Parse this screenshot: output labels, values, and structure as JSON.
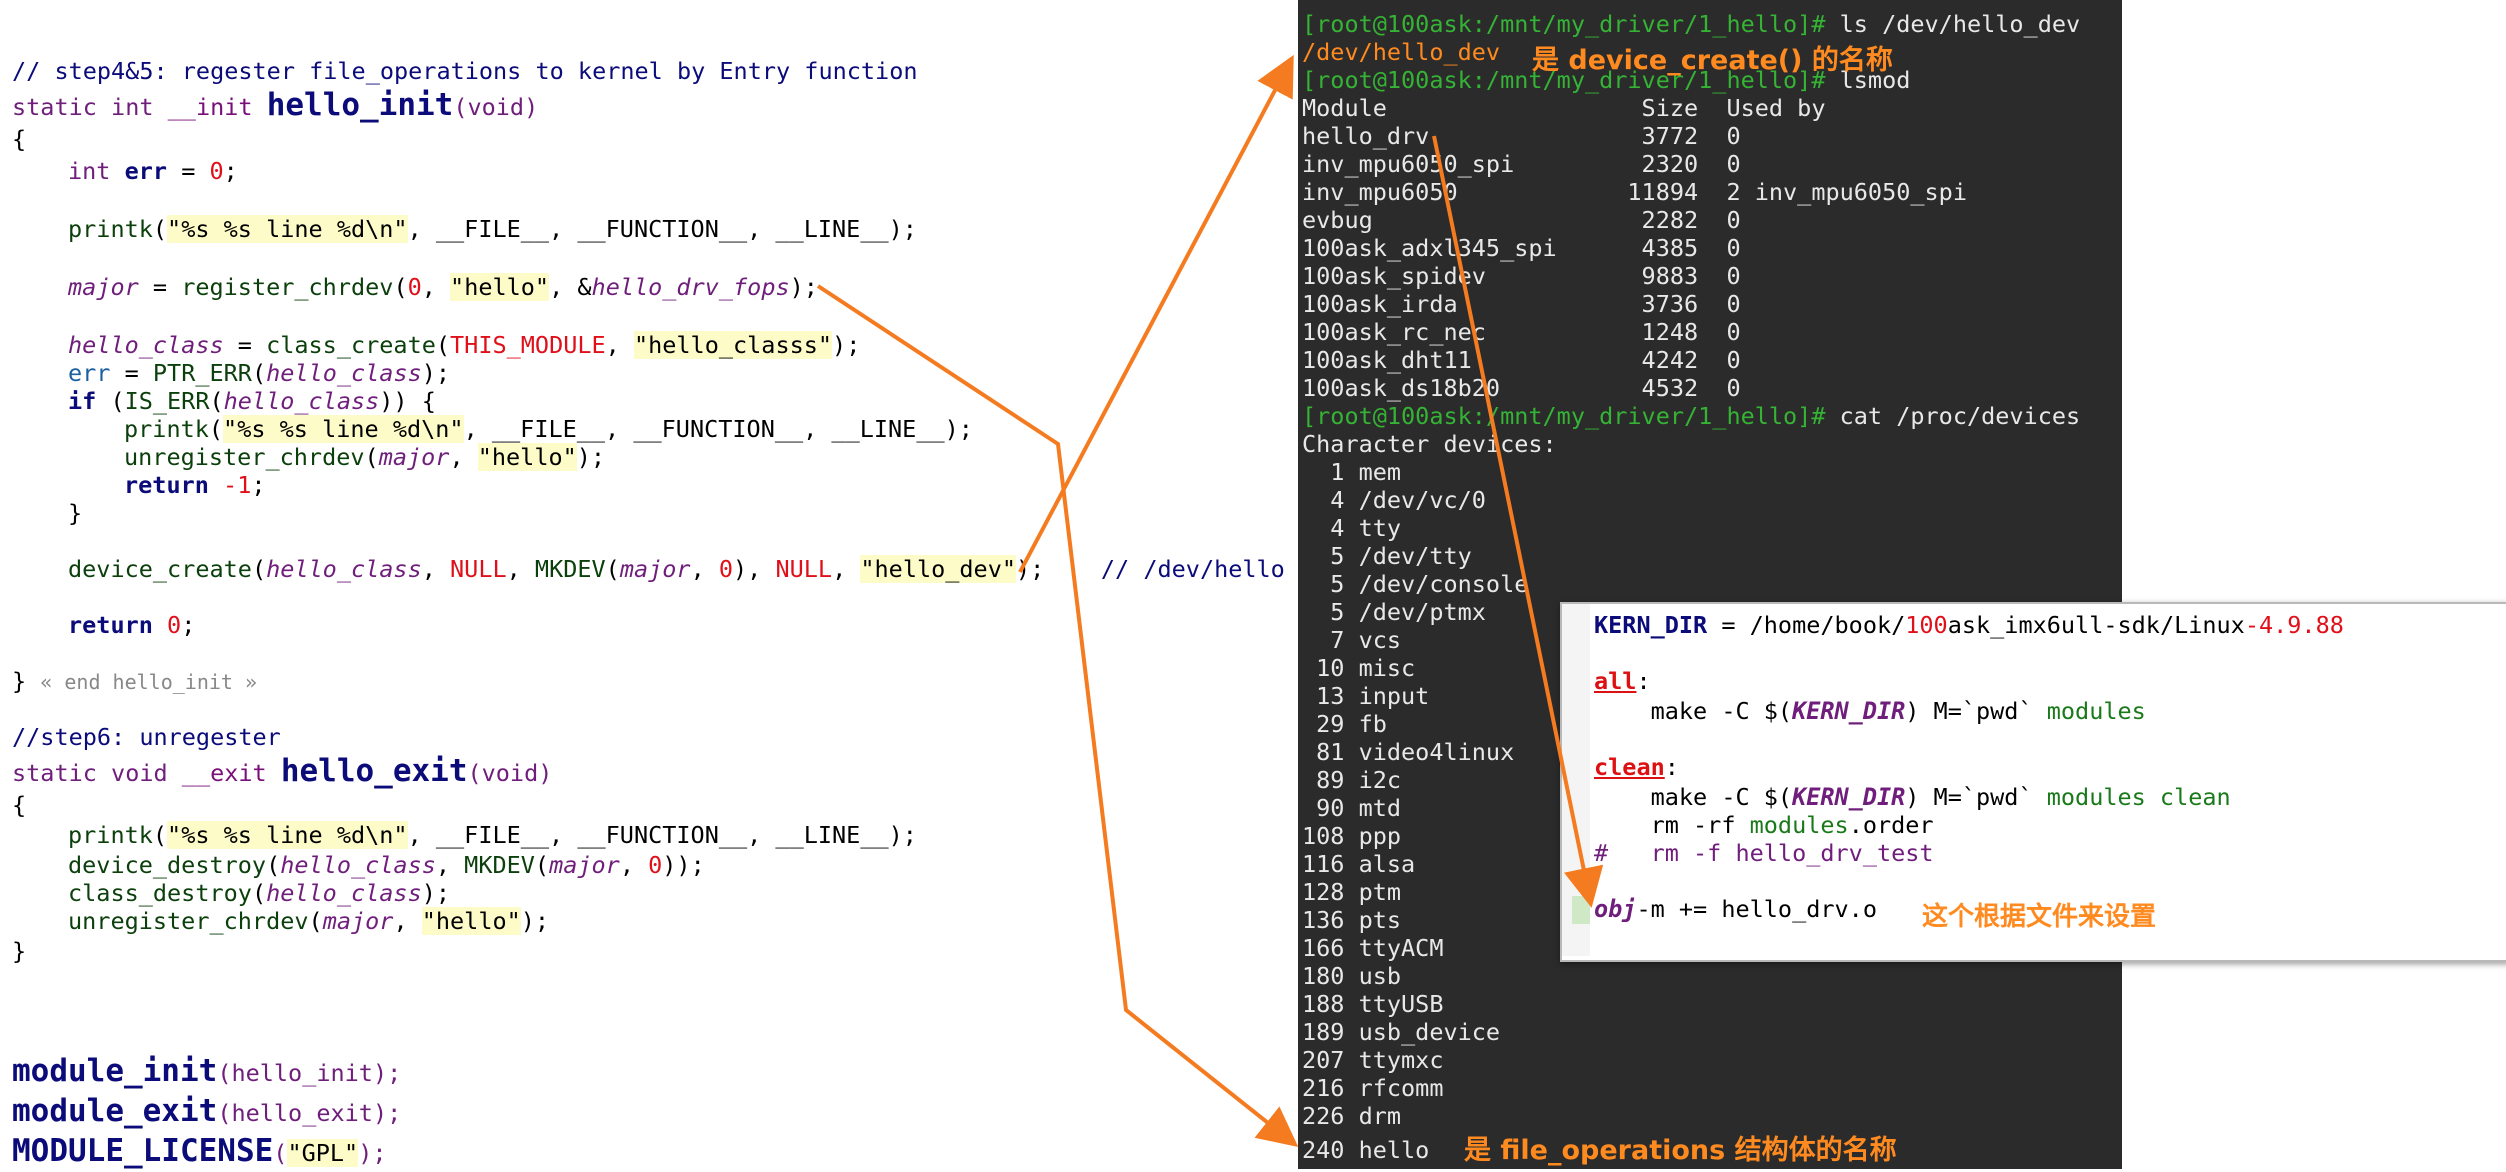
{
  "editor": {
    "comment_step45": "// step4&5: regester file_operations to kernel by Entry function",
    "init_sig": {
      "kw_static": "static",
      "type": "int",
      "macro": "__init",
      "name": "hello_init",
      "args": "(void)"
    },
    "open_brace": "{",
    "err_decl": {
      "type": "int",
      "name": "err",
      "rest": " = ",
      "val": "0",
      "end": ";"
    },
    "printk": {
      "fn": "printk",
      "fmt": "\"%s %s line %d\\n\"",
      "rest": ", __FILE__, __FUNCTION__, __LINE__);"
    },
    "major_line": {
      "var": "major",
      "eq": " = ",
      "fn": "register_chrdev",
      "a1": "0",
      "a2": "\"hello\"",
      "amp": ", &",
      "a3": "hello_drv_fops",
      "end": ");"
    },
    "class_line": {
      "var": "hello_class",
      "eq": " = ",
      "fn": "class_create",
      "a1": "THIS_MODULE",
      "a2": "\"hello_classs\"",
      "end": ");"
    },
    "err_line": {
      "var": "err",
      "eq": " = ",
      "fn": "PTR_ERR",
      "a1": "hello_class",
      "end": ");"
    },
    "if_line": {
      "kw": "if",
      "fn": "IS_ERR",
      "a1": "hello_class",
      "end": ")) {"
    },
    "printk2": {
      "fn": "printk",
      "fmt": "\"%s %s line %d\\n\"",
      "rest": ", __FILE__, __FUNCTION__, __LINE__);"
    },
    "unreg_line": {
      "fn": "unregister_chrdev",
      "a1": "major",
      "a2": "\"hello\"",
      "end": ");"
    },
    "return_neg": {
      "kw": "return",
      "val": "-1",
      "end": ";"
    },
    "close_if": "}",
    "dev_create": {
      "fn": "device_create",
      "a1": "hello_class",
      "a2": "NULL",
      "mk": "MKDEV",
      "a3": "major",
      "a4": "0",
      "a5": "NULL",
      "a6": "\"hello_dev\"",
      "end": ");",
      "comment": "// /dev/hello"
    },
    "return0": {
      "kw": "return",
      "val": "0",
      "end": ";"
    },
    "end_fold": "« end hello_init »",
    "comment_step6": "//step6: unregester",
    "exit_sig": {
      "kw_static": "static",
      "type": "void",
      "macro": "__exit",
      "name": "hello_exit",
      "args": "(void)"
    },
    "printk3": {
      "fn": "printk",
      "fmt": "\"%s %s line %d\\n\"",
      "rest": ", __FILE__, __FUNCTION__, __LINE__);"
    },
    "dev_destroy": {
      "fn": "device_destroy",
      "a1": "hello_class",
      "mk": "MKDEV",
      "a2": "major",
      "a3": "0",
      "end": "));"
    },
    "class_destroy": {
      "fn": "class_destroy",
      "a1": "hello_class",
      "end": ");"
    },
    "unreg2": {
      "fn": "unregister_chrdev",
      "a1": "major",
      "a2": "\"hello\"",
      "end": ");"
    },
    "close_brace": "}",
    "module_init": {
      "fn": "module_init",
      "arg": "(hello_init);"
    },
    "module_exit": {
      "fn": "module_exit",
      "arg": "(hello_exit);"
    },
    "module_license": {
      "fn": "MODULE_LICENSE",
      "lp": "(",
      "arg": "\"GPL\"",
      "rp": ");"
    }
  },
  "terminal": {
    "prompt": "[root@100ask:/mnt/my_driver/1_hello]#",
    "cmd_ls": " ls /dev/hello_dev",
    "ls_out": "/dev/hello_dev",
    "cmd_lsmod": " lsmod",
    "lsmod_header": "Module                  Size  Used by",
    "modules": [
      "hello_drv               3772  0",
      "inv_mpu6050_spi         2320  0",
      "inv_mpu6050            11894  2 inv_mpu6050_spi",
      "evbug                   2282  0",
      "100ask_adxl345_spi      4385  0",
      "100ask_spidev           9883  0",
      "100ask_irda             3736  0",
      "100ask_rc_nec           1248  0",
      "100ask_dht11            4242  0",
      "100ask_ds18b20          4532  0"
    ],
    "cmd_cat": " cat /proc/devices",
    "char_header": "Character devices:",
    "devices": [
      "  1 mem",
      "  4 /dev/vc/0",
      "  4 tty",
      "  5 /dev/tty",
      "  5 /dev/console",
      "  5 /dev/ptmx",
      "  7 vcs",
      " 10 misc",
      " 13 input",
      " 29 fb",
      " 81 video4linux",
      " 89 i2c",
      " 90 mtd",
      "108 ppp",
      "116 alsa",
      "128 ptm",
      "136 pts",
      "166 ttyACM",
      "180 usb",
      "188 ttyUSB",
      "189 usb_device",
      "207 ttymxc",
      "216 rfcomm",
      "226 drm",
      "240 hello"
    ]
  },
  "makefile": {
    "kern_var": "KERN_DIR",
    "kern_eq": " = /home/book/",
    "kern_num": "100",
    "kern_mid": "ask_imx6ull-sdk/Linux",
    "kern_ver": "-4.9.88",
    "all": "all",
    "colon": ":",
    "make1": "    make -C $(",
    "kd": "KERN_DIR",
    "make1b": ") M=`pwd` ",
    "modules": "modules",
    "clean": "clean",
    "make2b": ") M=`pwd` ",
    "modules_clean": "modules clean",
    "rm1a": "    rm -rf ",
    "rm1b": "modules",
    "rm1c": ".order",
    "rm2": "#   rm -f hello_drv_test",
    "obj": "obj",
    "obj_rest": "-m += hello_drv.o"
  },
  "annotations": {
    "dev_name": "是 device_create() 的名称",
    "file_ops": "是 file_operations 结构体的名称",
    "by_file": "这个根据文件来设置"
  },
  "colors": {
    "arrow": "#f47b20",
    "annotation": "#ff8a1f",
    "prompt": "#35b335",
    "terminal_bg": "#2b2b2b"
  }
}
